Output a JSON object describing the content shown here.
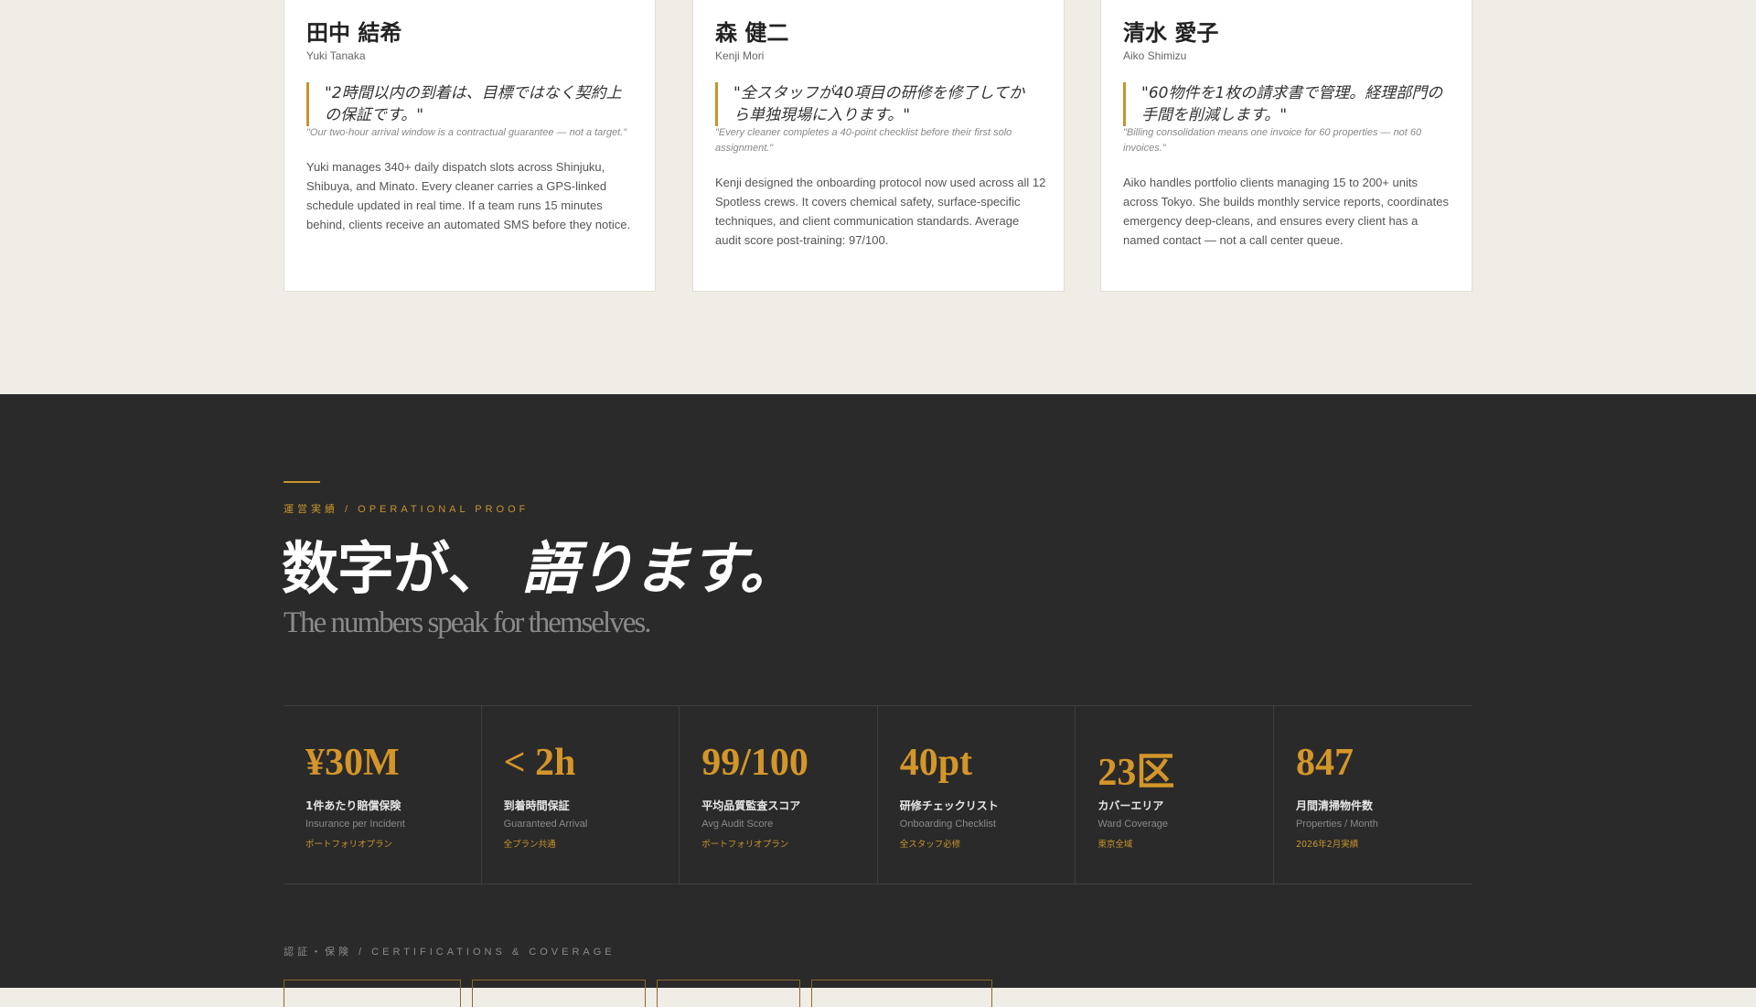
{
  "team": {
    "members": [
      {
        "name_jp": "田中 結希",
        "name_en": "Yuki Tanaka",
        "quote_jp": "\"2時間以内の到着は、目標ではなく契約上の保証です。\"",
        "quote_en": "\"Our two-hour arrival window is a contractual guarantee — not a target.\"",
        "bio": "Yuki manages 340+ daily dispatch slots across Shinjuku, Shibuya, and Minato. Every cleaner carries a GPS-linked schedule updated in real time. If a team runs 15 minutes behind, clients receive an automated SMS before they notice."
      },
      {
        "name_jp": "森 健二",
        "name_en": "Kenji Mori",
        "quote_jp": "\"全スタッフが40項目の研修を修了してから単独現場に入ります。\"",
        "quote_en": "\"Every cleaner completes a 40-point checklist before their first solo assignment.\"",
        "bio": "Kenji designed the onboarding protocol now used across all 12 Spotless crews. It covers chemical safety, surface-specific techniques, and client communication standards. Average audit score post-training: 97/100."
      },
      {
        "name_jp": "清水 愛子",
        "name_en": "Aiko Shimizu",
        "quote_jp": "\"60物件を1枚の請求書で管理。経理部門の手間を削減します。\"",
        "quote_en": "\"Billing consolidation means one invoice for 60 properties — not 60 invoices.\"",
        "bio": "Aiko handles portfolio clients managing 15 to 200+ units across Tokyo. She builds monthly service reports, coordinates emergency deep-cleans, and ensures every client has a named contact — not a call center queue."
      }
    ]
  },
  "proof": {
    "eyebrow": "運営実績 / OPERATIONAL PROOF",
    "headline_a": "数字が、",
    "headline_b": "語ります。",
    "subtitle": "The numbers speak for themselves.",
    "stats": [
      {
        "value": "¥30M",
        "label_jp": "1件あたり賠償保険",
        "label_en": "Insurance per Incident",
        "note": "ポートフォリオプラン"
      },
      {
        "value": "< 2h",
        "label_jp": "到着時間保証",
        "label_en": "Guaranteed Arrival",
        "note": "全プラン共通"
      },
      {
        "value": "99/100",
        "label_jp": "平均品質監査スコア",
        "label_en": "Avg Audit Score",
        "note": "ポートフォリオプラン"
      },
      {
        "value": "40pt",
        "label_jp": "研修チェックリスト",
        "label_en": "Onboarding Checklist",
        "note": "全スタッフ必修"
      },
      {
        "value": "23区",
        "label_jp": "カバーエリア",
        "label_en": "Ward Coverage",
        "note": "東京全域"
      },
      {
        "value": "847",
        "label_jp": "月間清掃物件数",
        "label_en": "Properties / Month",
        "note": "2026年2月実績"
      }
    ],
    "cert_label": "認証・保険 / CERTIFICATIONS & COVERAGE"
  },
  "colors": {
    "accent": "#c8942a",
    "dark_bg": "#2a2a2a",
    "light_bg": "#f0ece6"
  }
}
